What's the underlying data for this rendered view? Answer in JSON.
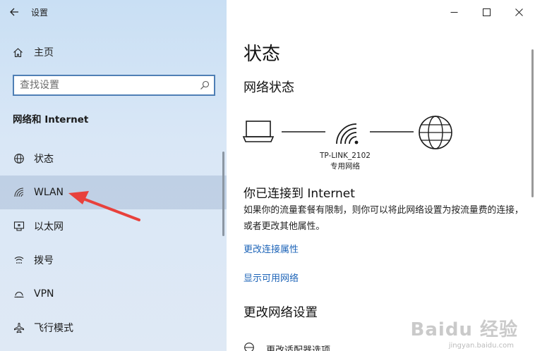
{
  "window": {
    "title": "设置"
  },
  "sidebar": {
    "home_label": "主页",
    "search_placeholder": "查找设置",
    "section_title": "网络和 Internet",
    "items": [
      {
        "label": "状态",
        "icon": "globe-status-icon"
      },
      {
        "label": "WLAN",
        "icon": "wifi-icon",
        "selected": true
      },
      {
        "label": "以太网",
        "icon": "ethernet-icon"
      },
      {
        "label": "拨号",
        "icon": "dialup-icon"
      },
      {
        "label": "VPN",
        "icon": "vpn-icon"
      },
      {
        "label": "飞行模式",
        "icon": "airplane-icon"
      }
    ]
  },
  "main": {
    "title": "状态",
    "network_status_heading": "网络状态",
    "network_name": "TP-LINK_2102",
    "network_type": "专用网络",
    "connected_heading": "你已连接到 Internet",
    "description": "如果你的流量套餐有限制，则你可以将此网络设置为按流量费的连接，或者更改其他属性。",
    "link_change_properties": "更改连接属性",
    "link_show_networks": "显示可用网络",
    "change_heading": "更改网络设置",
    "adapter_option": "更改适配器选项"
  },
  "watermark": {
    "brand": "Baidu 经验",
    "url": "jingyan.baidu.com"
  },
  "colors": {
    "accent": "#1d64b8",
    "arrow": "#e8413c"
  }
}
